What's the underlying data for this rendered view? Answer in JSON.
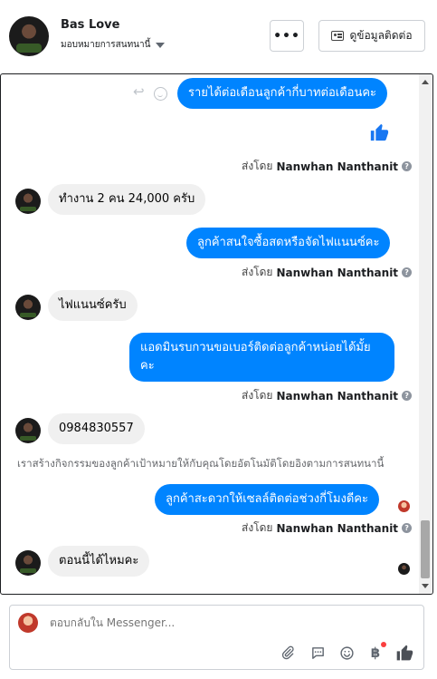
{
  "header": {
    "name": "Bas Love",
    "assign_label": "มอบหมายการสนทนานี้",
    "more_label": "•••",
    "contact_label": "ดูข้อมูลติดต่อ"
  },
  "messages": {
    "m1": "รายได้ต่อเดือนลูกค้ากี่บาทต่อเดือนคะ",
    "m2": "ทำงาน 2 คน 24,000 ครับ",
    "m3": "ลูกค้าสนใจซื้อสดหรือจัดไฟแนนซ์คะ",
    "m4": "ไฟแนนซ์ครับ",
    "m5_line1": "แอดมินรบกวนขอเบอร์ติดต่อลูกค้าหน่อยได้มั้ย",
    "m5_line2": "คะ",
    "m6": "0984830557",
    "m7": "ลูกค้าสะดวกให้เซลล์ติดต่อช่วงกี่โมงดีคะ",
    "m8": "ตอนนี้ได้ไหมคะ"
  },
  "sent_by": {
    "prefix": "ส่งโดย",
    "agent": "Nanwhan Nanthanit",
    "help": "?"
  },
  "system_note": "เราสร้างกิจกรรมของลูกค้าเป้าหมายให้กับคุณโดยอัตโนมัติโดยอิงตามการสนทนานี้",
  "composer": {
    "placeholder": "ตอบกลับใน Messenger..."
  },
  "colors": {
    "outgoing_bubble": "#0084ff",
    "incoming_bubble": "#f0f0f0",
    "like_blue": "#1877f2"
  },
  "icons": [
    "reply-icon",
    "reaction-icon",
    "like-icon",
    "attachment-icon",
    "saved-replies-icon",
    "emoji-icon",
    "currency-icon",
    "send-like-icon"
  ]
}
